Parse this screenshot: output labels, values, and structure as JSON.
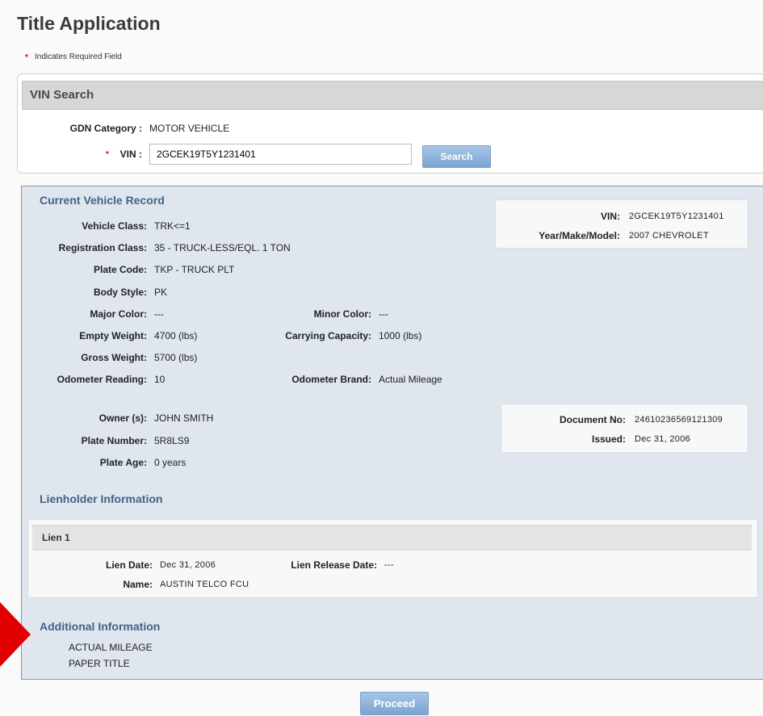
{
  "page": {
    "title": "Title Application",
    "required_note": "Indicates Required Field",
    "required_marker": "*"
  },
  "vin_search": {
    "header": "VIN Search",
    "gdn_label": "GDN Category :",
    "gdn_value": "MOTOR VEHICLE",
    "vin_label": "VIN :",
    "vin_value": "2GCEK19T5Y1231401",
    "search_label": "Search"
  },
  "current_record": {
    "header": "Current Vehicle Record",
    "vehicle_class": {
      "label": "Vehicle Class:",
      "value": "TRK<=1"
    },
    "registration_class": {
      "label": "Registration Class:",
      "value": "35 - TRUCK-LESS/EQL. 1 TON"
    },
    "plate_code": {
      "label": "Plate Code:",
      "value": "TKP - TRUCK PLT"
    },
    "body_style": {
      "label": "Body Style:",
      "value": "PK"
    },
    "major_color": {
      "label": "Major Color:",
      "value": "---"
    },
    "minor_color": {
      "label": "Minor Color:",
      "value": "---"
    },
    "empty_weight": {
      "label": "Empty Weight:",
      "value": "4700 (lbs)"
    },
    "carrying_capacity": {
      "label": "Carrying Capacity:",
      "value": "1000 (lbs)"
    },
    "gross_weight": {
      "label": "Gross Weight:",
      "value": "5700 (lbs)"
    },
    "odometer_reading": {
      "label": "Odometer Reading:",
      "value": "10"
    },
    "odometer_brand": {
      "label": "Odometer Brand:",
      "value": "Actual Mileage"
    },
    "owners": {
      "label": "Owner (s):",
      "value": "JOHN SMITH"
    },
    "plate_number": {
      "label": "Plate Number:",
      "value": "5R8LS9"
    },
    "plate_age": {
      "label": "Plate Age:",
      "value": "0 years"
    },
    "summary": {
      "vin_label": "VIN:",
      "vin_value": "2GCEK19T5Y1231401",
      "ymm_label": "Year/Make/Model:",
      "ymm_value": "2007 CHEVROLET"
    },
    "document": {
      "doc_label": "Document No:",
      "doc_value": "24610236569121309",
      "issued_label": "Issued:",
      "issued_value": "Dec 31, 2006"
    }
  },
  "lienholder": {
    "header": "Lienholder Information",
    "lien_title": "Lien 1",
    "lien_date_label": "Lien Date:",
    "lien_date_value": "Dec 31, 2006",
    "release_label": "Lien Release Date:",
    "release_value": "---",
    "name_label": "Name:",
    "name_value": "AUSTIN TELCO FCU"
  },
  "additional": {
    "header": "Additional Information",
    "lines": [
      "ACTUAL MILEAGE",
      "PAPER TITLE"
    ]
  },
  "actions": {
    "proceed_label": "Proceed"
  },
  "colors": {
    "section_title": "#44628a",
    "required_star": "#d8001a",
    "button": "#8ab0da",
    "panel_bg": "#dfe6ed",
    "arrow": "#e00000"
  }
}
